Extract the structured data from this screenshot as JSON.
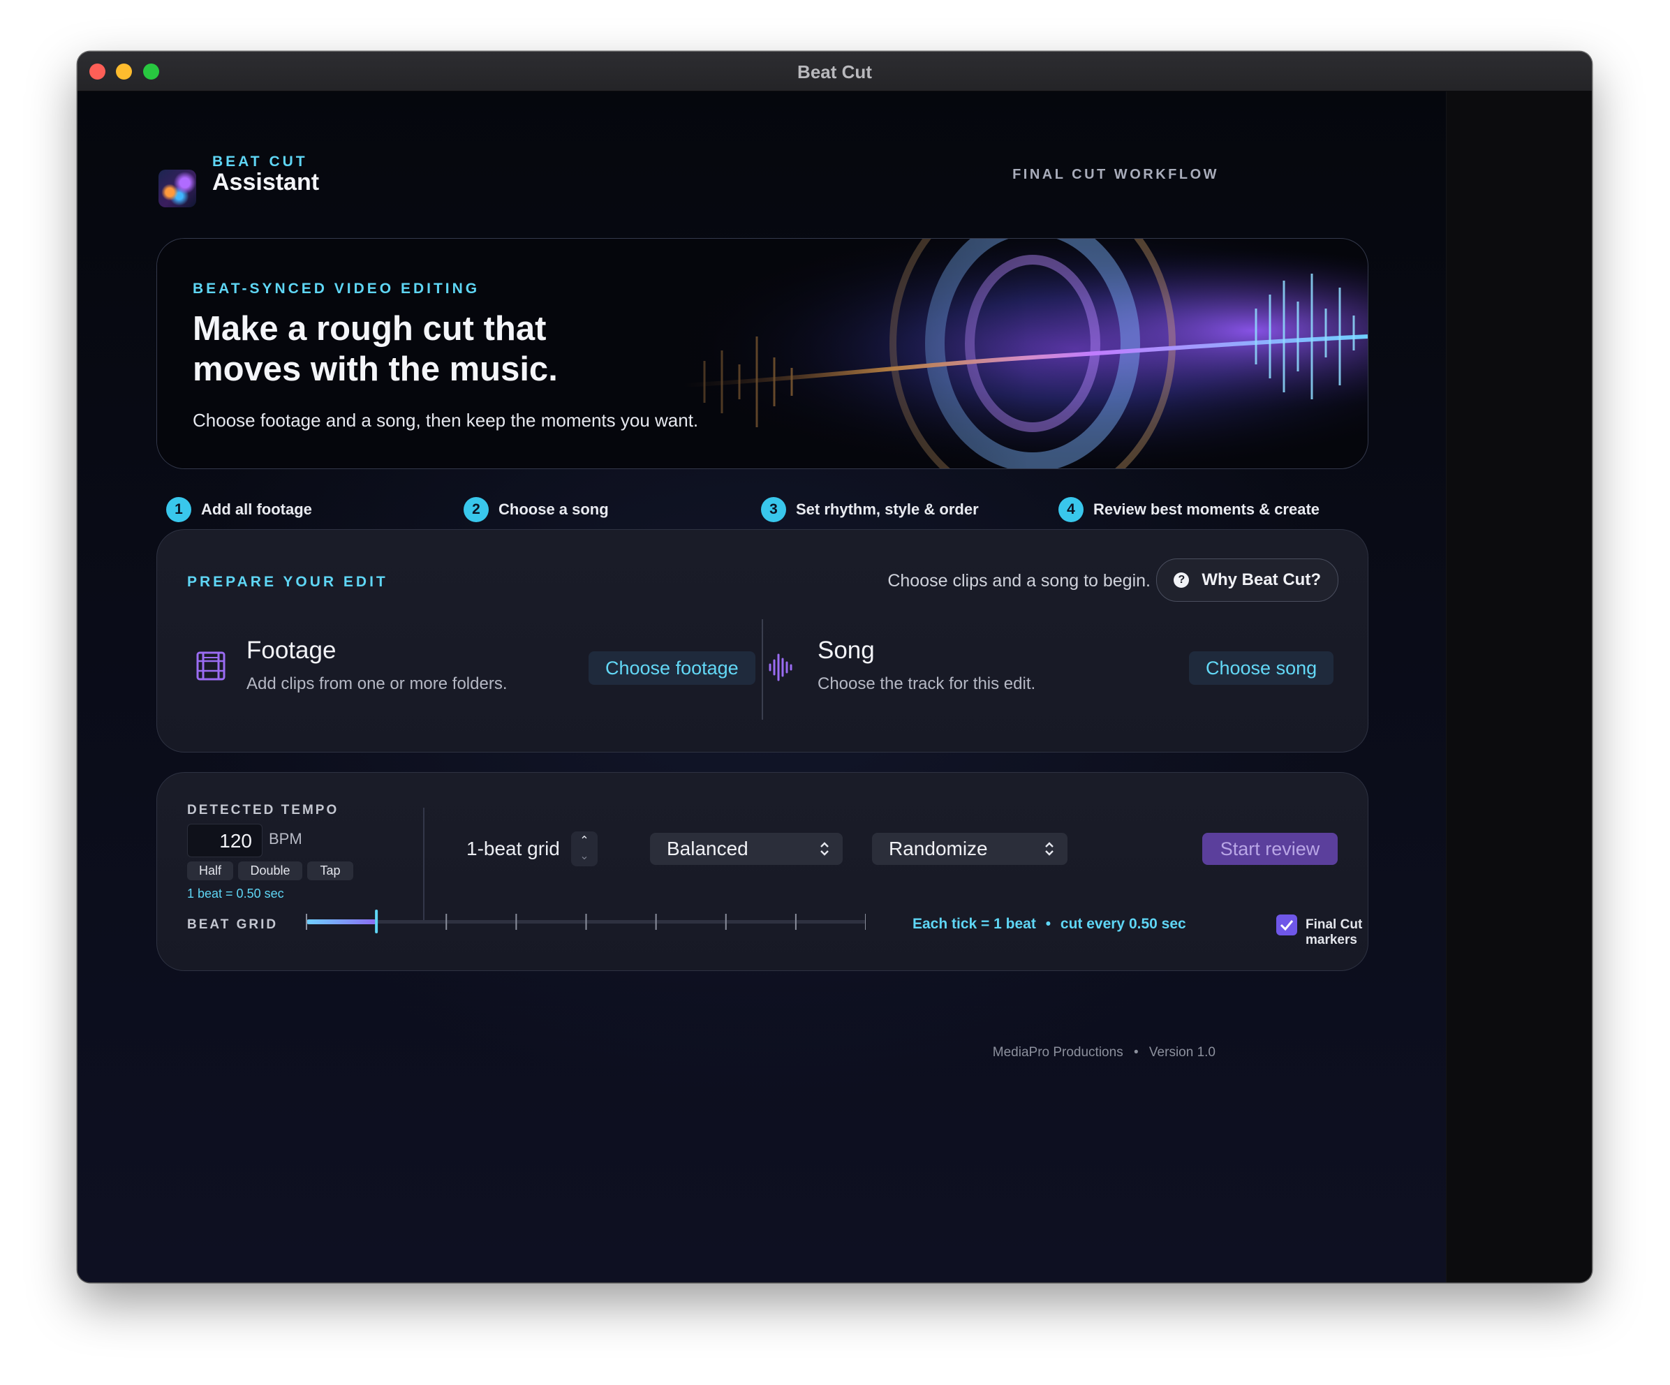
{
  "window": {
    "title": "Beat Cut"
  },
  "header": {
    "brand_top": "BEAT CUT",
    "brand_main": "Assistant",
    "workflow_label": "FINAL CUT WORKFLOW"
  },
  "hero": {
    "eyebrow": "BEAT-SYNCED VIDEO EDITING",
    "headline": "Make a rough cut that moves with the music.",
    "subline": "Choose footage and a song, then keep the moments you want."
  },
  "steps": [
    {
      "number": "1",
      "label": "Add all footage"
    },
    {
      "number": "2",
      "label": "Choose a song"
    },
    {
      "number": "3",
      "label": "Set rhythm, style & order"
    },
    {
      "number": "4",
      "label": "Review best moments & create"
    }
  ],
  "prepare": {
    "eyebrow": "PREPARE YOUR EDIT",
    "status": "Choose clips and a song to begin.",
    "why_button": "Why Beat Cut?",
    "why_icon": "?",
    "footage": {
      "icon": "film-icon",
      "title": "Footage",
      "description": "Add clips from one or more folders.",
      "button": "Choose footage"
    },
    "song": {
      "icon": "waveform-icon",
      "title": "Song",
      "description": "Choose the track for this edit.",
      "button": "Choose song"
    }
  },
  "tempo": {
    "eyebrow": "DETECTED TEMPO",
    "bpm_value": "120",
    "bpm_unit": "BPM",
    "buttons": {
      "half": "Half",
      "double": "Double",
      "tap": "Tap"
    },
    "beat_note": "1 beat = 0.50 sec",
    "grid_label": "1-beat grid",
    "style_select": "Balanced",
    "order_select": "Randomize",
    "start_button": "Start review",
    "beat_grid_label": "BEAT GRID",
    "beat_grid_ticks": 9,
    "beat_grid_progress": 0.125,
    "info_tick": "Each tick = 1 beat",
    "info_sep": "•",
    "info_cut": "cut every 0.50 sec",
    "final_cut_markers_label": "Final Cut markers",
    "final_cut_markers_checked": true
  },
  "footer": {
    "company": "MediaPro Productions",
    "sep": "•",
    "version": "Version 1.0"
  },
  "colors": {
    "accent_cyan": "#5fd6f5",
    "accent_purple": "#6f57e8",
    "start_button": "#5b3f9c",
    "background": "#0b0d18"
  }
}
